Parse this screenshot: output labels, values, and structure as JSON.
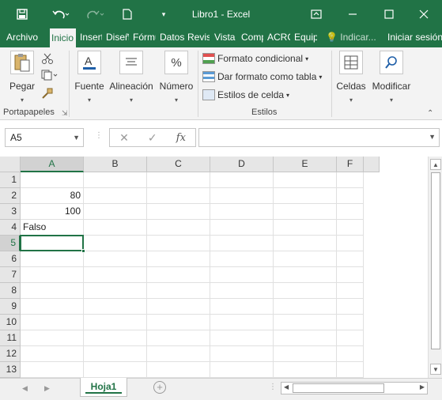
{
  "window": {
    "title": "Libro1 - Excel",
    "colors": {
      "accent": "#217346",
      "ribbon_bg": "#f3f3f3"
    }
  },
  "quick_access": {
    "save_icon": "save-icon",
    "undo_icon": "undo-icon",
    "redo_icon": "redo-icon",
    "new_icon": "new-document-icon"
  },
  "tabs": [
    {
      "label": "Archivo"
    },
    {
      "label": "Inicio",
      "active": true
    },
    {
      "label": "Insertar"
    },
    {
      "label": "Diseño de página"
    },
    {
      "label": "Fórmulas"
    },
    {
      "label": "Datos"
    },
    {
      "label": "Revisar"
    },
    {
      "label": "Vista"
    },
    {
      "label": "Complementos"
    },
    {
      "label": "ACROBAT"
    },
    {
      "label": "Equipo"
    }
  ],
  "tell_me": "Indicar...",
  "sign_in": "Iniciar sesión",
  "ribbon": {
    "clipboard": {
      "paste": "Pegar",
      "group": "Portapapeles"
    },
    "font": "Fuente",
    "alignment": "Alineación",
    "number": "Número",
    "styles": {
      "conditional": "Formato condicional",
      "as_table": "Dar formato como tabla",
      "cell_styles": "Estilos de celda",
      "group": "Estilos"
    },
    "cells": "Celdas",
    "editing": "Modificar"
  },
  "formula_bar": {
    "name_box": "A5",
    "fx": "fx",
    "formula": ""
  },
  "columns": [
    "A",
    "B",
    "C",
    "D",
    "E",
    "F"
  ],
  "rows": [
    "1",
    "2",
    "3",
    "4",
    "5",
    "6",
    "7",
    "8",
    "9",
    "10",
    "11",
    "12",
    "13"
  ],
  "cells": {
    "A2": "80",
    "A3": "100",
    "A4": "Falso"
  },
  "active_cell": "A5",
  "sheet": {
    "tab": "Hoja1"
  }
}
